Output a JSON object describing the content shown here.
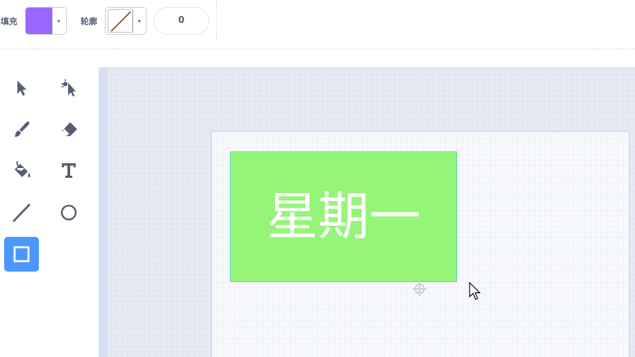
{
  "toolbar": {
    "fill_label": "填充",
    "fill_color": "#9966ff",
    "outline_label": "轮廓",
    "outline_value": "none",
    "stroke_width": "0",
    "dropdown_glyph": "▾"
  },
  "tools": [
    {
      "name": "select",
      "icon": "select-arrow-icon",
      "active": false
    },
    {
      "name": "reshape",
      "icon": "reshape-icon",
      "active": false
    },
    {
      "name": "brush",
      "icon": "brush-icon",
      "active": false
    },
    {
      "name": "eraser",
      "icon": "eraser-icon",
      "active": false
    },
    {
      "name": "fill",
      "icon": "paint-bucket-icon",
      "active": false
    },
    {
      "name": "text",
      "icon": "text-icon",
      "active": false
    },
    {
      "name": "line",
      "icon": "line-icon",
      "active": false
    },
    {
      "name": "circle",
      "icon": "circle-icon",
      "active": false
    },
    {
      "name": "rectangle",
      "icon": "rectangle-icon",
      "active": true
    }
  ],
  "canvas": {
    "shape_color": "#95f578",
    "shape_text": "星期一",
    "text_color": "#ffffff"
  }
}
